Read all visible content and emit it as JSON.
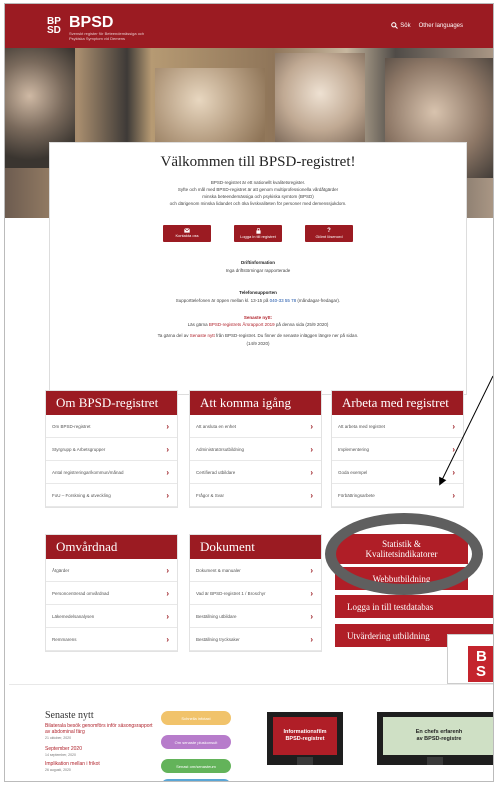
{
  "header": {
    "logo_mark_line1": "BP",
    "logo_mark_line2": "SD",
    "logo_title": "BPSD",
    "logo_subtitle": "Svenskt register för Beteendemässiga och Psykiska Symptom vid Demens",
    "search_label": "Sök",
    "other_languages_label": "Other languages",
    "brand_color": "#9b1b22"
  },
  "welcome": {
    "title": "Välkommen till BPSD-registret!",
    "intro_lines": [
      "BPSD-registret är ett nationellt kvalitetsregister.",
      "Syfte och mål med BPSD-registret är att genom multiprofessionella vårdåtgärder",
      "minska beteendemässiga och psykiska symtom (BPSD)",
      "och därigenom minska lidandet och öka livskvaliteten för personer med demenssjukdom."
    ],
    "buttons": [
      {
        "icon": "mail-icon",
        "label": "Kontakta oss"
      },
      {
        "icon": "lock-icon",
        "label": "Logga in till registret"
      },
      {
        "icon": "help-icon",
        "label": "Glömt lösenord"
      }
    ],
    "drift_heading": "Driftinformation",
    "drift_text": "Inga driftstörningar rapporterade",
    "phone_heading": "Telefonsupporten",
    "phone_text_before": "Supporttelefonen är öppen mellan kl. 13-15 på ",
    "phone_number": "040-33 55 78",
    "phone_text_after": " (måndagar-fredagar).",
    "news_heading": "Senaste nytt:",
    "news_line1_before": "Läs gärna ",
    "news_line1_link": "BPSD-registrets Årsrapport 2019",
    "news_line1_after": " på denna sida (25/9 2020)",
    "news_line2_before": "Ta gärna del av ",
    "news_line2_link": "Senaste nytt",
    "news_line2_after": " från BPSD-registret. Du finner de senaste inläggen längre ner på sidan.",
    "news_line3": "(14/9 2020)"
  },
  "cards_top": [
    {
      "title": "Om BPSD-registret",
      "items": [
        "Om BPSD-registret",
        "Styrgrupp & Arbetsgrupper",
        "Antal registreringar/kommun/månad",
        "FoU – Forskning & utveckling"
      ]
    },
    {
      "title": "Att komma igång",
      "items": [
        "Att ansluta en enhet",
        "Administratörsutbildning",
        "Certifierad utbildare",
        "Frågor & Svar"
      ]
    },
    {
      "title": "Arbeta med registret",
      "items": [
        "Att arbeta med registret",
        "Implementering",
        "Goda exempel",
        "Förbättringsarbete"
      ]
    }
  ],
  "cards_bottom": [
    {
      "title": "Omvårdnad",
      "items": [
        "Åtgärder",
        "Personcentrerad omvårdnad",
        "Läkemedelsanalysen",
        "Remmarens"
      ]
    },
    {
      "title": "Dokument",
      "items": [
        "Dokument & manualer",
        "Vad är BPSD-registret 1 / Broschyr",
        "Beställning utbildare",
        "Beställning trycksaker"
      ]
    }
  ],
  "red_buttons": [
    {
      "label_line1": "Statistik &",
      "label_line2": "Kvalitetsindikatorer"
    },
    {
      "label_line1": "Webbutbildning",
      "label_line2": ""
    },
    {
      "label_line1": "Logga in till testdatabas",
      "label_line2": ""
    },
    {
      "label_line1": "Utvärdering utbildning",
      "label_line2": ""
    }
  ],
  "zoom_logo": {
    "line1": "B",
    "line2": "S"
  },
  "news": {
    "title": "Senaste nytt",
    "items": [
      {
        "title": "Bilaterala besök genomförs inför säsongsrapport av abdominal färg",
        "date": "21 oktober, 2020"
      },
      {
        "title": "September 2020",
        "date": "14 september, 2020"
      },
      {
        "title": "Implikation mellan i frikot",
        "date": "26 augusti, 2020"
      }
    ]
  },
  "pills": [
    {
      "label": "Schnella infotaxi",
      "color": "#f1c36b"
    },
    {
      "label": "Om senaste pluskonsult",
      "color": "#b77ccb"
    },
    {
      "label": "Senast om/senasteum",
      "color": "#63b35a"
    },
    {
      "label": "",
      "color": "#5aa6d6"
    }
  ],
  "videos": [
    {
      "line1": "Informationsfilm",
      "line2": "BPSD-registret",
      "color": "#b01e27",
      "text_color": "#ffffff"
    },
    {
      "line1": "En chefs erfarenh",
      "line2": "av BPSD-registre",
      "color": "#cfe0c5",
      "text_color": "#222222"
    }
  ]
}
